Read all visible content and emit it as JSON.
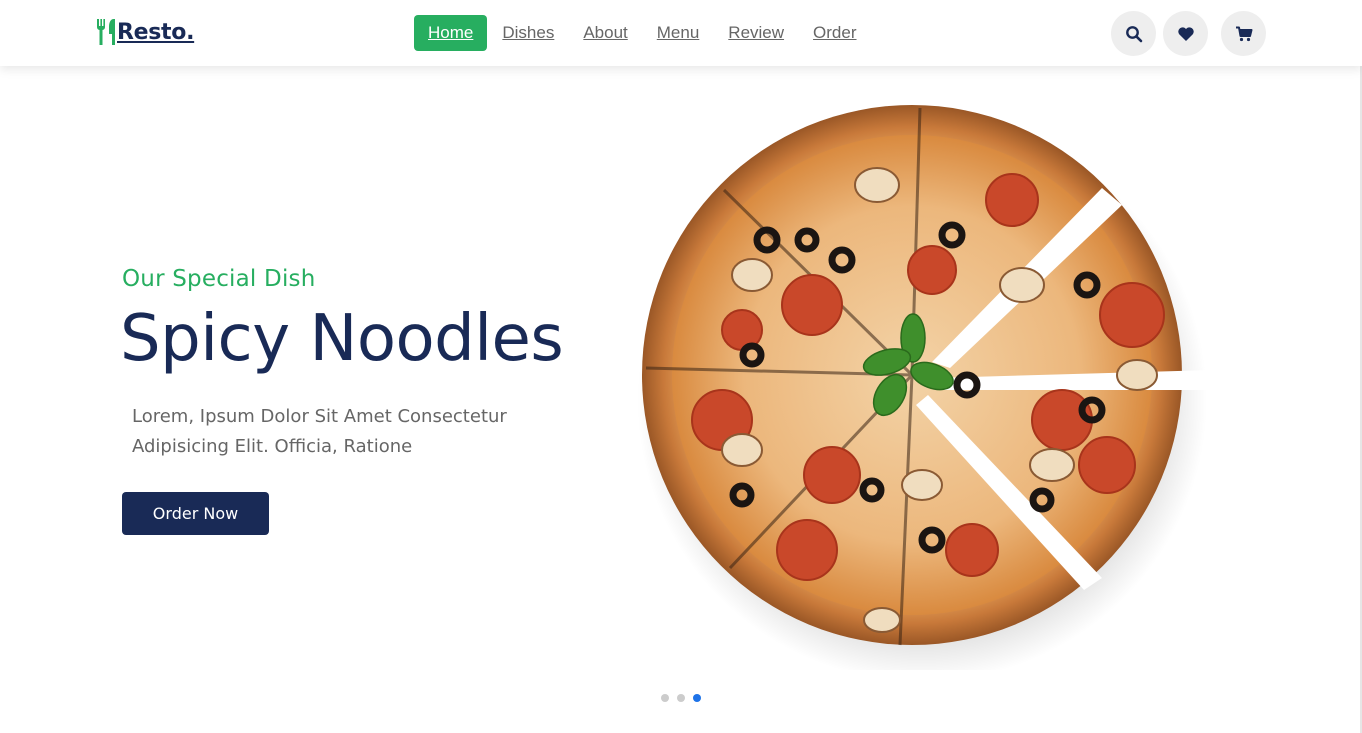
{
  "header": {
    "logo_text": "Resto.",
    "logo_icon": "utensils-icon",
    "nav": [
      {
        "label": "Home",
        "active": true
      },
      {
        "label": "Dishes",
        "active": false
      },
      {
        "label": "About",
        "active": false
      },
      {
        "label": "Menu",
        "active": false
      },
      {
        "label": "Review",
        "active": false
      },
      {
        "label": "Order",
        "active": false
      }
    ],
    "icons": [
      "search-icon",
      "heart-icon",
      "cart-icon"
    ]
  },
  "hero": {
    "subtitle": "Our Special Dish",
    "title": "Spicy Noodles",
    "description": "Lorem, Ipsum Dolor Sit Amet Consectetur Adipisicing Elit. Officia, Ratione",
    "button_label": "Order Now",
    "image": "pizza-image",
    "slides_total": 3,
    "slide_active": 3
  },
  "colors": {
    "brand_green": "#27ae60",
    "navy": "#192a56",
    "text_gray": "#666666",
    "dot_active": "#1e73e8"
  }
}
